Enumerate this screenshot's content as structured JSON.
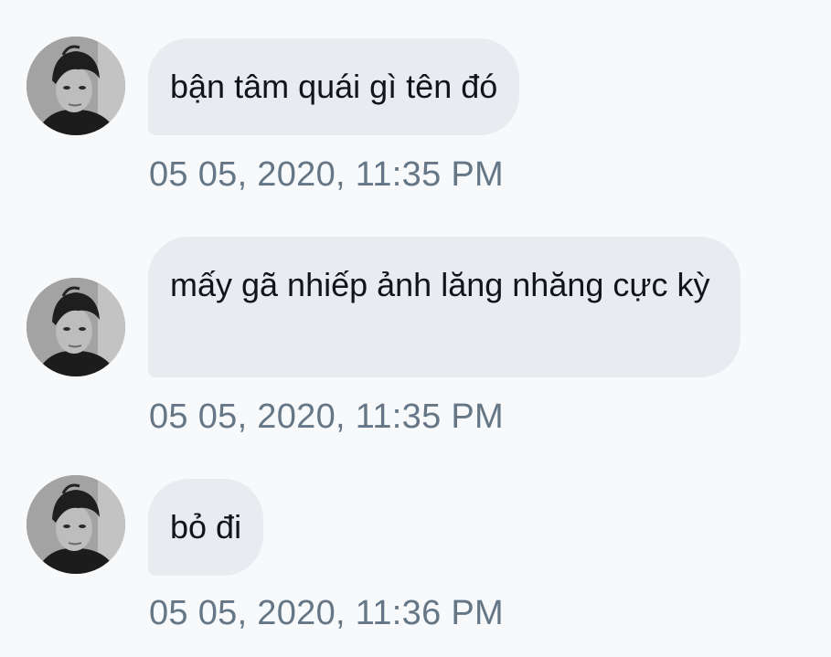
{
  "messages": [
    {
      "avatar_icon": "profile-photo-avatar",
      "text": "bận tâm quái gì tên đó",
      "timestamp": "05 05, 2020, 11:35 PM"
    },
    {
      "avatar_icon": "profile-photo-avatar",
      "text": "mấy gã nhiếp ảnh lăng nhăng cực kỳ",
      "timestamp": "05 05, 2020, 11:35 PM"
    },
    {
      "avatar_icon": "profile-photo-avatar",
      "text": "bỏ đi",
      "timestamp": "05 05, 2020, 11:36 PM"
    }
  ],
  "colors": {
    "background": "#f8f9fa",
    "bubble": "#e8ecf0",
    "bubble_text": "#111418",
    "timestamp": "#657786"
  }
}
